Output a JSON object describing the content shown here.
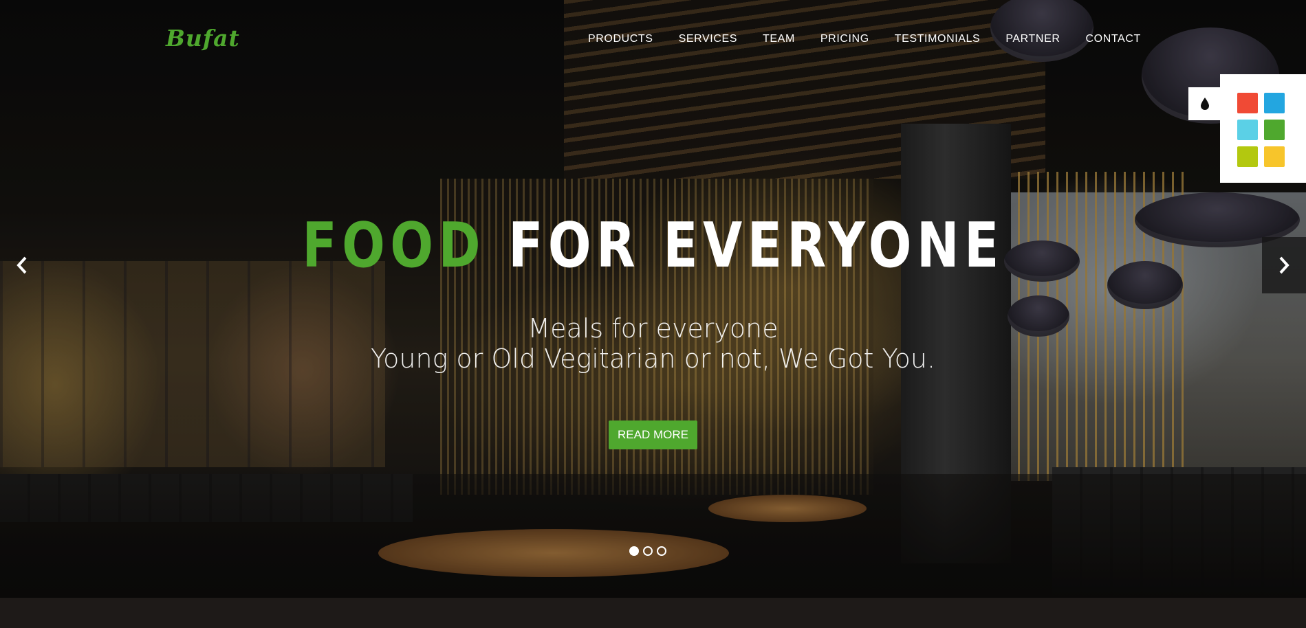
{
  "brand": {
    "logo_text": "Bufat",
    "accent_color": "#4fa82e"
  },
  "nav": {
    "items": [
      "PRODUCTS",
      "SERVICES",
      "TEAM",
      "PRICING",
      "TESTIMONIALS",
      "PARTNER",
      "CONTACT"
    ]
  },
  "hero": {
    "title_accent": "FOOD",
    "title_rest": "FOR EVERYONE",
    "subtitle_line1": "Meals for everyone",
    "subtitle_line2": "Young or Old Vegitarian or not, We Got You.",
    "cta_label": "READ MORE"
  },
  "carousel": {
    "prev_icon": "chevron-left-icon",
    "next_icon": "chevron-right-icon",
    "slide_count": 3,
    "active_index": 0
  },
  "color_switcher": {
    "toggle_icon": "droplet-icon",
    "swatches": [
      "#f04a35",
      "#23a6e0",
      "#5bd0e6",
      "#4fa82e",
      "#b3c80f",
      "#f7c52b"
    ]
  }
}
